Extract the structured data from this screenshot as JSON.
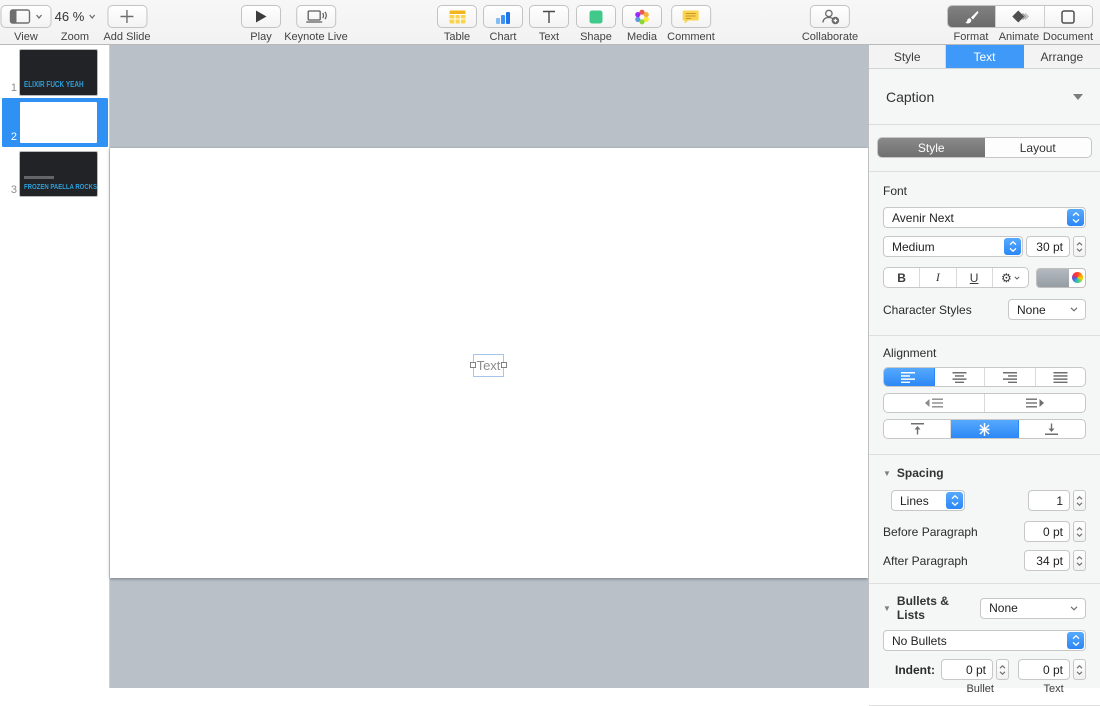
{
  "toolbar": {
    "view_label": "View",
    "zoom_label": "Zoom",
    "zoom_value": "46 %",
    "add_slide_label": "Add Slide",
    "play_label": "Play",
    "keynote_live_label": "Keynote Live",
    "table_label": "Table",
    "chart_label": "Chart",
    "text_label": "Text",
    "shape_label": "Shape",
    "media_label": "Media",
    "comment_label": "Comment",
    "collaborate_label": "Collaborate",
    "format_label": "Format",
    "animate_label": "Animate",
    "document_label": "Document"
  },
  "slide_navigator": {
    "selected_slide_number": "2",
    "slides": [
      {
        "number": "1",
        "title": "ELIXIR FUCK YEAH"
      },
      {
        "number": "2",
        "title": ""
      },
      {
        "number": "3",
        "title": "FROZEN PAELLA ROCKS"
      }
    ]
  },
  "canvas": {
    "text_placeholder": "Text"
  },
  "inspector": {
    "tabs": {
      "style": "Style",
      "text": "Text",
      "arrange": "Arrange",
      "selected": "Text"
    },
    "paragraph_style": "Caption",
    "mode_tabs": {
      "style": "Style",
      "layout": "Layout",
      "selected": "Style"
    },
    "font": {
      "section_label": "Font",
      "family": "Avenir Next",
      "typeface": "Medium",
      "size": "30 pt",
      "bold": "B",
      "italic": "I",
      "underline": "U"
    },
    "character_styles": {
      "label": "Character Styles",
      "value": "None"
    },
    "alignment_label": "Alignment",
    "spacing": {
      "label": "Spacing",
      "mode": "Lines",
      "value": "1",
      "before_label": "Before Paragraph",
      "before_value": "0 pt",
      "after_label": "After Paragraph",
      "after_value": "34 pt"
    },
    "bullets": {
      "label": "Bullets & Lists",
      "value": "None",
      "list_style": "No Bullets",
      "indent_label": "Indent:",
      "bullet_value": "0 pt",
      "text_value": "0 pt",
      "bullet_caption": "Bullet",
      "text_caption": "Text"
    }
  },
  "colors": {
    "accent_blue": "#3b99fc",
    "canvas_gray": "#b9c0c8",
    "thumb_dark": "#212326",
    "thumb_text_blue": "#2da0da"
  }
}
